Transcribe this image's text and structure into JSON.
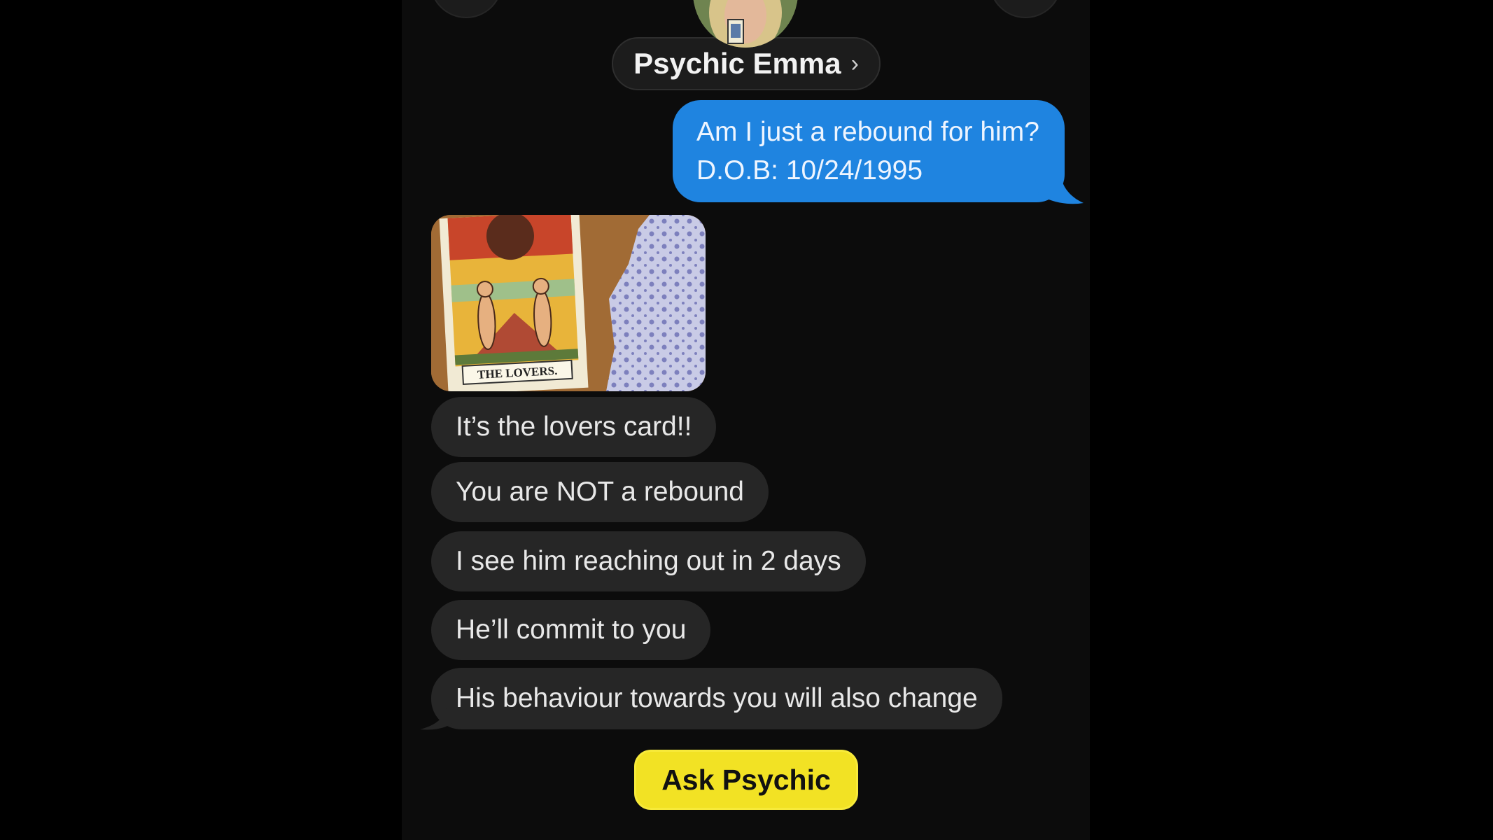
{
  "contact": {
    "name": "Psychic Emma",
    "chevron": "›"
  },
  "messages": {
    "sent": {
      "line1": "Am I just a rebound for him?",
      "line2": "D.O.B: 10/24/1995"
    },
    "received_image": {
      "card_caption": "THE LOVERS."
    },
    "received": [
      "It’s the lovers card!!",
      "You are NOT a rebound",
      "I see him reaching out in 2 days",
      "He’ll commit to you",
      "His behaviour towards you will also change"
    ]
  },
  "action": {
    "ask_label": "Ask Psychic"
  },
  "colors": {
    "sent_bubble": "#1f84e0",
    "received_bubble": "#262626",
    "ask_button": "#f2e224",
    "background": "#0c0c0c"
  },
  "icons": {
    "back": "back-button",
    "info": "info-button",
    "chevron": "chevron-right-icon"
  }
}
